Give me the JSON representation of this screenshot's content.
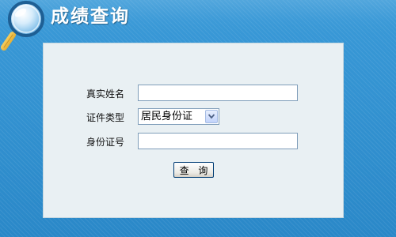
{
  "header": {
    "title": "成绩查询",
    "icon": "magnifier-icon"
  },
  "form": {
    "name_label": "真实姓名",
    "name_value": "",
    "id_type_label": "证件类型",
    "id_type_selected": "居民身份证",
    "id_number_label": "身份证号",
    "id_number_value": "",
    "submit_label": "查 询"
  },
  "colors": {
    "background": "#2b8fd0",
    "panel": "#e9f0f3",
    "title_text": "#ffffff",
    "button_border": "#003c74"
  }
}
